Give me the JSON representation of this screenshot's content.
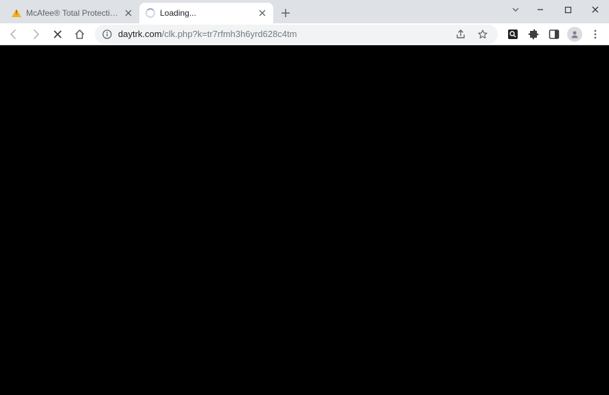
{
  "tabs": [
    {
      "title": "McAfee® Total Protection"
    },
    {
      "title": "Loading..."
    }
  ],
  "url": {
    "domain": "daytrk.com",
    "path": "/clk.php?k=tr7rfmh3h6yrd628c4tm"
  }
}
